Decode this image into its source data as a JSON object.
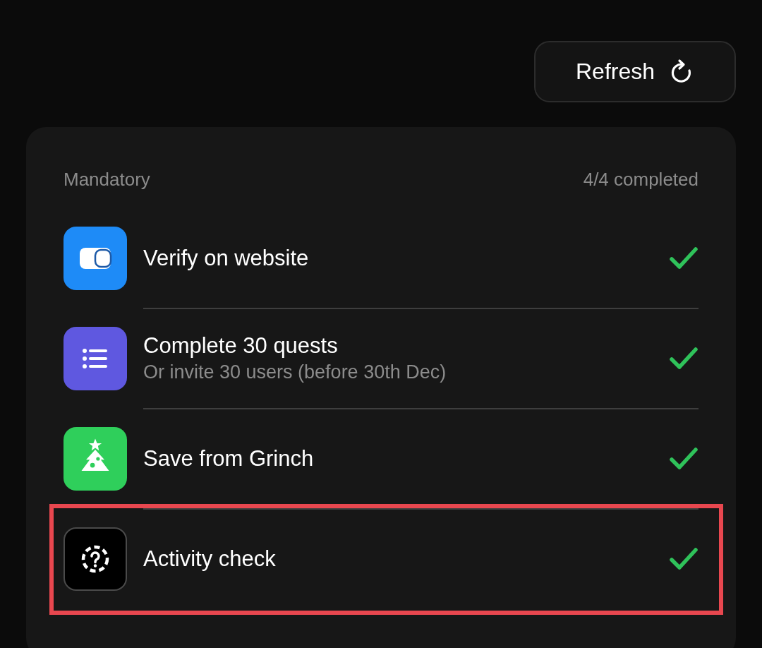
{
  "refresh_button": {
    "label": "Refresh"
  },
  "section": {
    "title": "Mandatory",
    "progress": "4/4 completed"
  },
  "tasks": [
    {
      "kind": "wallet",
      "color": "#1e8bf7",
      "title": "Verify on website",
      "completed": true,
      "highlighted": false
    },
    {
      "kind": "list",
      "color": "#5f58e0",
      "title": "Complete 30 quests",
      "subtitle": "Or invite 30 users (before 30th Dec)",
      "completed": true,
      "highlighted": false
    },
    {
      "kind": "tree",
      "color": "#2fcf5b",
      "title": "Save from Grinch",
      "completed": true,
      "highlighted": false
    },
    {
      "kind": "question",
      "color": "#000000",
      "title": "Activity check",
      "completed": true,
      "highlighted": true
    }
  ]
}
